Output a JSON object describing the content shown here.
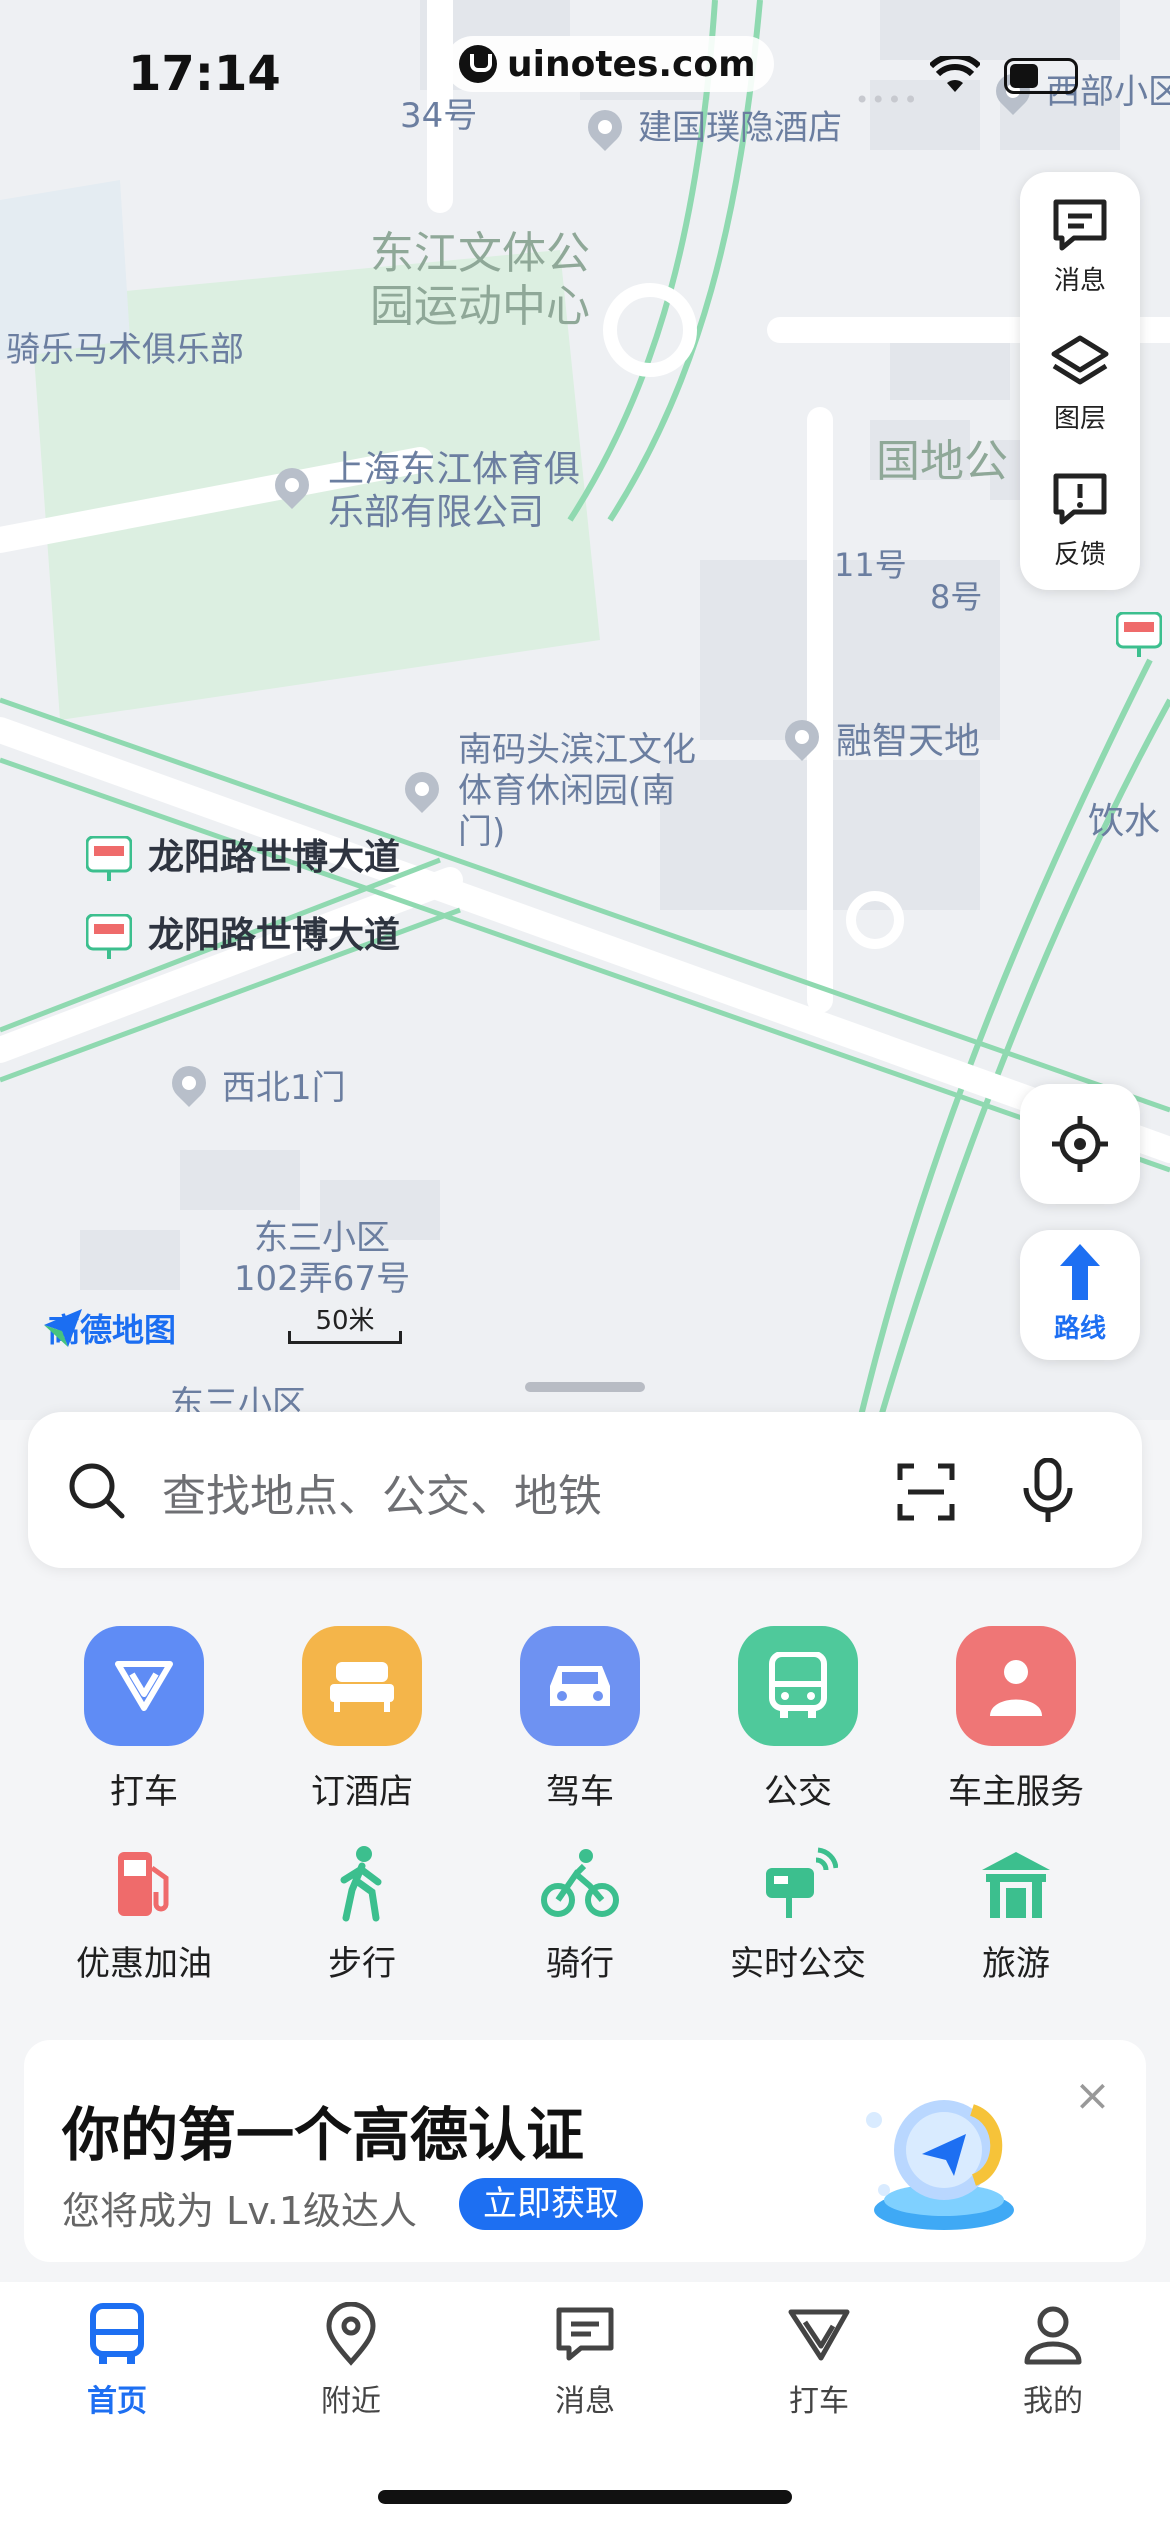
{
  "status_bar": {
    "time": "17:14",
    "watermark": "uinotes.com"
  },
  "map": {
    "labels": [
      {
        "text": "34号"
      },
      {
        "text": "建国璞隐酒店"
      },
      {
        "text": "东江文体公园运动中心"
      },
      {
        "text": "骑乐马术俱乐部"
      },
      {
        "text": "上海东江体育俱乐部有限公司"
      },
      {
        "text": "国地公"
      },
      {
        "text": "11号"
      },
      {
        "text": "8号"
      },
      {
        "text": "南码头滨江文化体育休闲园(南门)"
      },
      {
        "text": "融智天地"
      },
      {
        "text": "饮水"
      },
      {
        "text": "龙阳路世博大道"
      },
      {
        "text": "龙阳路世博大道"
      },
      {
        "text": "西北1门"
      },
      {
        "text": "东三小区102弄67号"
      },
      {
        "text": "西部小区"
      },
      {
        "text": "东三小区"
      }
    ],
    "logo": "高德地图",
    "scale": "50米"
  },
  "right_panel": {
    "messages": "消息",
    "layers": "图层",
    "feedback": "反馈",
    "route": "路线"
  },
  "search": {
    "placeholder": "查找地点、公交、地铁"
  },
  "services": [
    {
      "label": "打车",
      "color": "#5f8cf5"
    },
    {
      "label": "订酒店",
      "color": "#f4b54a"
    },
    {
      "label": "驾车",
      "color": "#6e92f2"
    },
    {
      "label": "公交",
      "color": "#4fc99b"
    },
    {
      "label": "车主服务",
      "color": "#ef7676"
    }
  ],
  "shortcuts": [
    {
      "label": "优惠加油",
      "color": "#ef6b6b"
    },
    {
      "label": "步行",
      "color": "#3cbf8e"
    },
    {
      "label": "骑行",
      "color": "#3cbf8e"
    },
    {
      "label": "实时公交",
      "color": "#3cbf8e"
    },
    {
      "label": "旅游",
      "color": "#3cbf8e"
    }
  ],
  "banner": {
    "title": "你的第一个高德认证",
    "subtitle": "您将成为 Lv.1级达人",
    "cta": "立即获取"
  },
  "tabbar": {
    "home": "首页",
    "nearby": "附近",
    "messages": "消息",
    "taxi": "打车",
    "mine": "我的",
    "accent": "#1d6ff2"
  }
}
